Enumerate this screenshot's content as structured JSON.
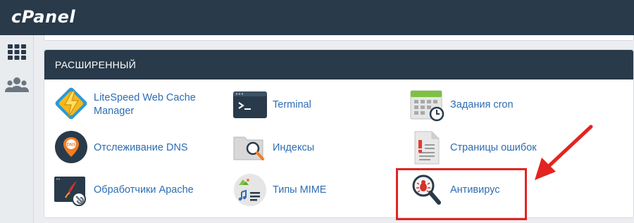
{
  "app": {
    "logo_text": "cPanel"
  },
  "sidebar": {
    "items": [
      {
        "name": "grid-icon"
      },
      {
        "name": "users-icon"
      }
    ]
  },
  "section": {
    "title": "РАСШИРЕННЫЙ",
    "items": [
      {
        "label": "LiteSpeed Web Cache Manager",
        "icon": "litespeed-icon"
      },
      {
        "label": "Terminal",
        "icon": "terminal-icon"
      },
      {
        "label": "Задания cron",
        "icon": "cron-calendar-icon"
      },
      {
        "label": "Отслеживание DNS",
        "icon": "dns-pin-icon"
      },
      {
        "label": "Индексы",
        "icon": "folder-search-icon"
      },
      {
        "label": "Страницы ошибок",
        "icon": "error-page-icon"
      },
      {
        "label": "Обработчики Apache",
        "icon": "apache-handlers-icon"
      },
      {
        "label": "Типы MIME",
        "icon": "mime-types-icon"
      },
      {
        "label": "Антивирус",
        "icon": "antivirus-icon"
      }
    ]
  },
  "annotation": {
    "highlight_color": "#e32421",
    "highlighted_item": "Антивирус"
  }
}
